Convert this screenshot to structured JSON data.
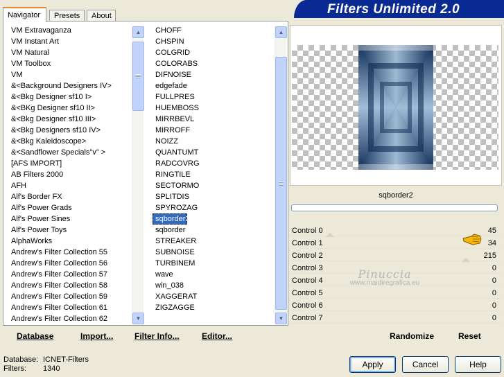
{
  "tabs": [
    {
      "label": "Navigator"
    },
    {
      "label": "Presets"
    },
    {
      "label": "About"
    }
  ],
  "title": "Filters Unlimited 2.0",
  "categories": [
    "VM Extravaganza",
    "VM Instant Art",
    "VM Natural",
    "VM Toolbox",
    "VM",
    "&<Background Designers IV>",
    "&<Bkg Designer sf10 I>",
    "&<BKg Designer sf10 II>",
    "&<Bkg Designer sf10 III>",
    "&<Bkg Designers sf10 IV>",
    "&<Bkg Kaleidoscope>",
    "&<Sandflower Specials\"v\" >",
    "[AFS IMPORT]",
    "AB Filters 2000",
    "AFH",
    "Alf's Border FX",
    "Alf's Power Grads",
    "Alf's Power Sines",
    "Alf's Power Toys",
    "AlphaWorks",
    "Andrew's Filter Collection 55",
    "Andrew's Filter Collection 56",
    "Andrew's Filter Collection 57",
    "Andrew's Filter Collection 58",
    "Andrew's Filter Collection 59",
    "Andrew's Filter Collection 61",
    "Andrew's Filter Collection 62"
  ],
  "filters": [
    "CHOFF",
    "CHSPIN",
    "COLGRID",
    "COLORABS",
    "DIFNOISE",
    "edgefade",
    "FULLPRES",
    "HUEMBOSS",
    "MIRRBEVL",
    "MIRROFF",
    "NOIZZ",
    "QUANTUMT",
    "RADCOVRG",
    "RINGTILE",
    "SECTORMO",
    "SPLITDIS",
    "SPYROZAG",
    "sqborder2",
    "sqborder",
    "STREAKER",
    "SUBNOISE",
    "TURBINEM",
    "wave",
    "win_038",
    "XAGGERAT",
    "ZIGZAGGE"
  ],
  "selected_filter": "sqborder2",
  "left_buttons": {
    "database": "Database",
    "import": "Import...",
    "filter_info": "Filter Info...",
    "editor": "Editor..."
  },
  "filter_name": "sqborder2",
  "controls": [
    {
      "label": "Control 0",
      "value": "45"
    },
    {
      "label": "Control 1",
      "value": "34"
    },
    {
      "label": "Control 2",
      "value": "215"
    },
    {
      "label": "Control 3",
      "value": "0"
    },
    {
      "label": "Control 4",
      "value": "0"
    },
    {
      "label": "Control 5",
      "value": "0"
    },
    {
      "label": "Control 6",
      "value": "0"
    },
    {
      "label": "Control 7",
      "value": "0"
    }
  ],
  "watermark": {
    "name": "Pinuccia",
    "url": "www.maidiregrafica.eu"
  },
  "right_buttons": {
    "randomize": "Randomize",
    "reset": "Reset"
  },
  "status": {
    "database_label": "Database:",
    "database_value": "ICNET-Filters",
    "filters_label": "Filters:",
    "filters_value": "1340"
  },
  "dialog_buttons": {
    "apply": "Apply",
    "cancel": "Cancel",
    "help": "Help"
  },
  "colors": {
    "title_bar": "#0a2a93",
    "selection": "#316ac5",
    "preview_dark": "#17355e"
  }
}
